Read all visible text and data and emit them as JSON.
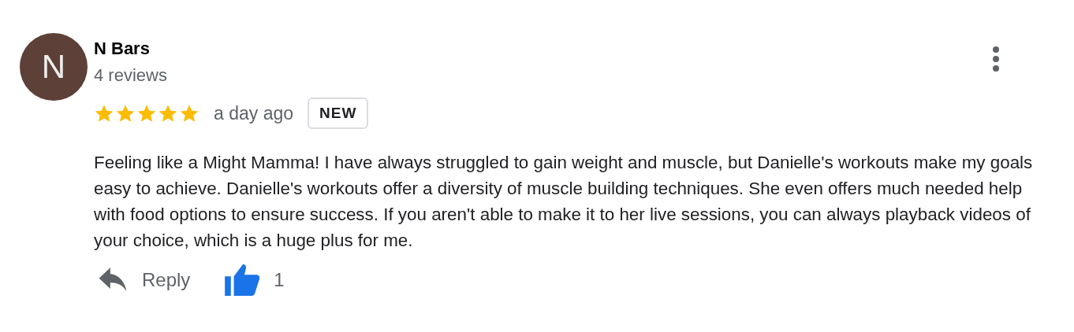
{
  "review": {
    "avatar_letter": "N",
    "author": "N Bars",
    "review_count": "4 reviews",
    "stars": 5,
    "time": "a day ago",
    "badge": "NEW",
    "text": "Feeling like a Might Mamma! I have always struggled to gain weight and muscle, but Danielle's workouts make my goals easy to achieve. Danielle's workouts offer a diversity of muscle building techniques. She even offers much needed help with food options to ensure success. If you aren't able to make it to her live sessions, you can always playback videos of your choice, which is a huge plus for me.",
    "reply_label": "Reply",
    "liked": true,
    "like_count": "1"
  }
}
